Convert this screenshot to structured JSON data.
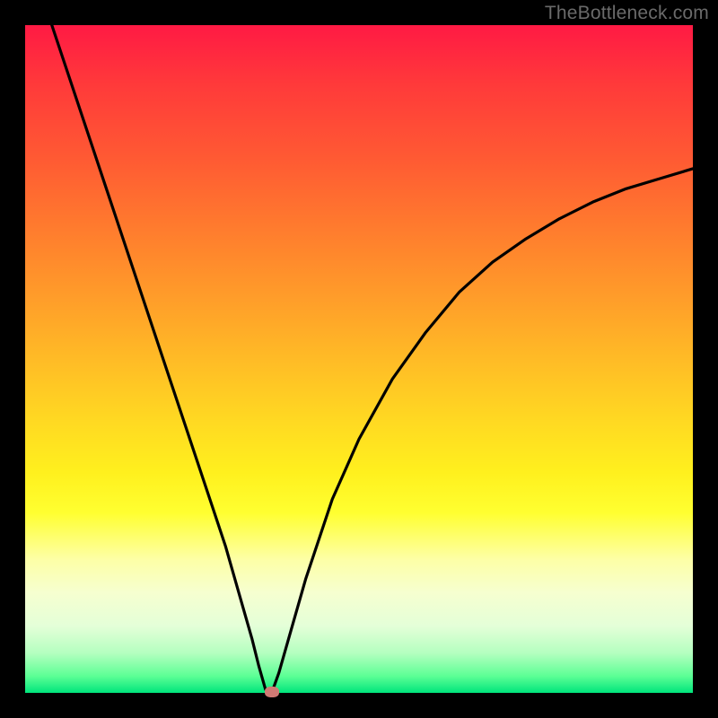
{
  "watermark": "TheBottleneck.com",
  "colors": {
    "frame": "#000000",
    "curve": "#000000",
    "marker": "#cf7a74"
  },
  "chart_data": {
    "type": "line",
    "title": "",
    "xlabel": "",
    "ylabel": "",
    "xlim": [
      0,
      100
    ],
    "ylim": [
      0,
      100
    ],
    "background_gradient": {
      "top": "#ff1a44",
      "bottom": "#00e57c",
      "meaning": "red = high bottleneck, green = low bottleneck"
    },
    "x": [
      4,
      6,
      8,
      10,
      12,
      14,
      16,
      18,
      20,
      22,
      24,
      26,
      28,
      30,
      32,
      34,
      35,
      36,
      37,
      38,
      40,
      42,
      44,
      46,
      50,
      55,
      60,
      65,
      70,
      75,
      80,
      85,
      90,
      95,
      100
    ],
    "values": [
      100,
      94,
      88,
      82,
      76,
      70,
      64,
      58,
      52,
      46,
      40,
      34,
      28,
      22,
      15,
      8,
      4,
      0.5,
      0.2,
      3,
      10,
      17,
      23,
      29,
      38,
      47,
      54,
      60,
      64.5,
      68,
      71,
      73.5,
      75.5,
      77,
      78.5
    ],
    "marker": {
      "x": 37,
      "y": 0.2
    },
    "notes": "V-shaped bottleneck curve; minimum near x≈37 at y≈0; left branch roughly linear, right branch concave rising toward ~78."
  }
}
